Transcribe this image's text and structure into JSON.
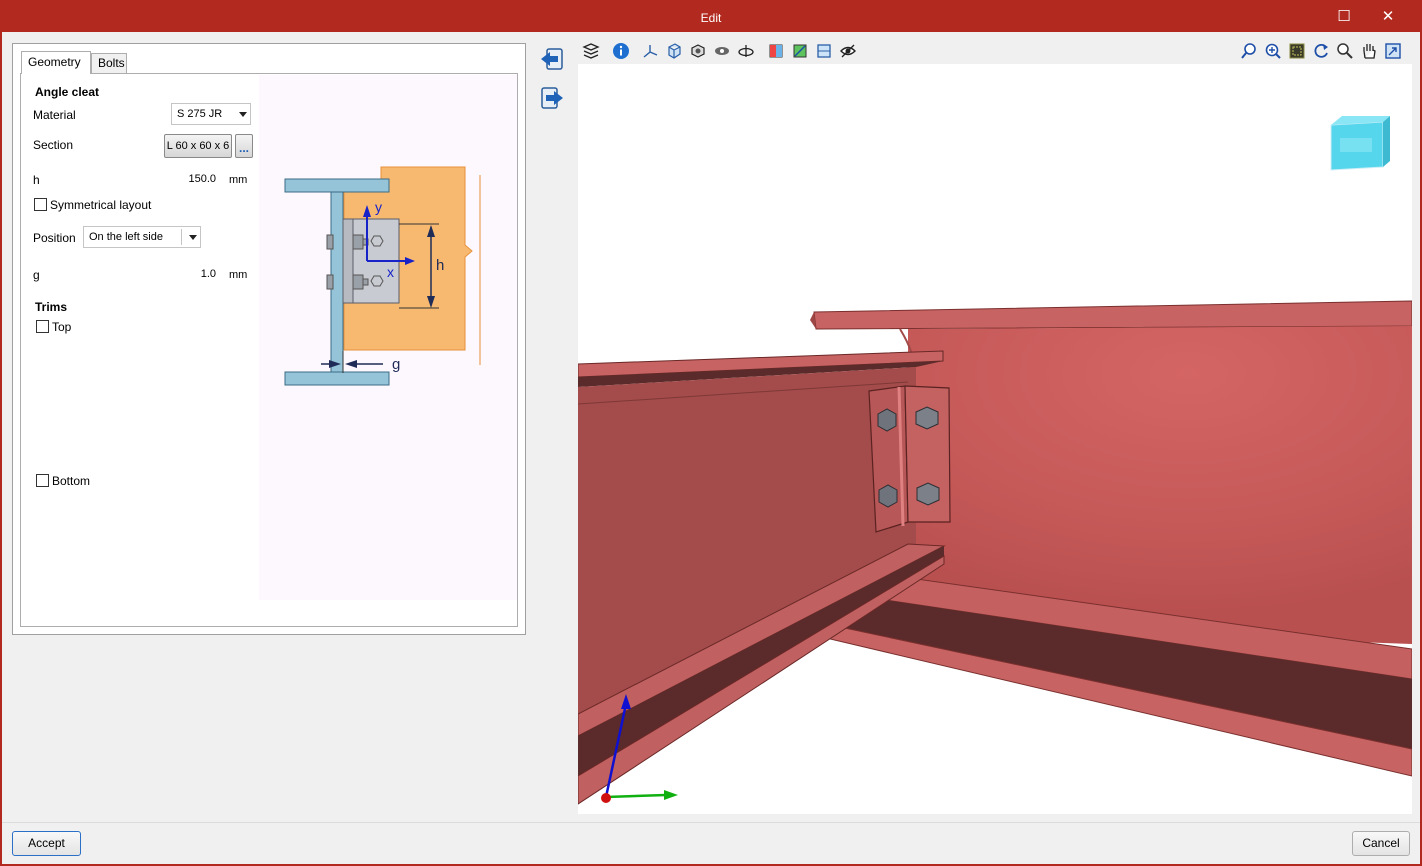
{
  "window": {
    "title": "Edit",
    "maximize_glyph": "☐",
    "close_glyph": "✕"
  },
  "tabs": [
    {
      "label": "Geometry"
    },
    {
      "label": "Bolts"
    }
  ],
  "form": {
    "section_title": "Angle cleat",
    "material_label": "Material",
    "material_value": "S 275 JR",
    "section_label": "Section",
    "section_value": "L 60 x 60 x 6",
    "section_more": "...",
    "h_label": "h",
    "h_value": "150.0",
    "h_unit": "mm",
    "symmetrical_label": "Symmetrical layout",
    "position_label": "Position",
    "position_value": "On the left side",
    "g_label": "g",
    "g_value": "1.0",
    "g_unit": "mm",
    "trims_title": "Trims",
    "top_label": "Top",
    "bottom_label": "Bottom"
  },
  "diagram": {
    "y_label": "y",
    "x_label": "x",
    "h_label": "h",
    "g_label": "g"
  },
  "buttons": {
    "accept": "Accept",
    "cancel": "Cancel"
  },
  "colors": {
    "title_bar": "#b22a1f",
    "beam_red": "#c65a59",
    "column_blue": "#95c4d8",
    "beam_orange": "#f7b970",
    "cleat_gray": "#c9cbd2"
  }
}
